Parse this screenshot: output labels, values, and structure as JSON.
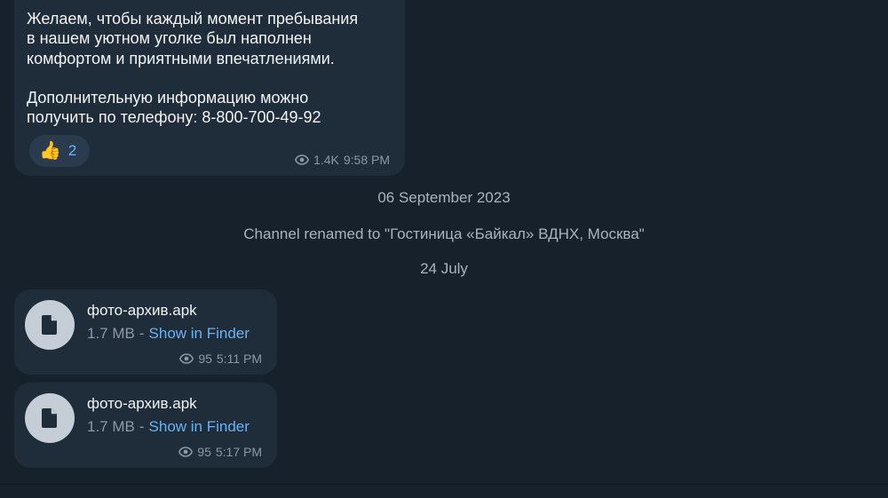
{
  "text_message": {
    "lines_1": [
      "Желаем, чтобы каждый момент пребывания",
      "в нашем уютном уголке был наполнен",
      "комфортом и приятными впечатлениями."
    ],
    "lines_2": [
      "Дополнительную информацию можно",
      "получить по телефону: 8-800-700-49-92"
    ],
    "reaction": {
      "emoji": "👍",
      "count": "2"
    },
    "views": "1.4K",
    "time": "9:58 PM"
  },
  "service": {
    "date_1": "06 September 2023",
    "rename": "Channel renamed to \"Гостиница «Байкал» ВДНХ, Москва\"",
    "date_2": "24 July"
  },
  "files": [
    {
      "name": "фото-архив.apk",
      "size": "1.7 MB",
      "separator": "-",
      "action": "Show in Finder",
      "views": "95",
      "time": "5:11 PM",
      "icon": "document-icon"
    },
    {
      "name": "фото-архив.apk",
      "size": "1.7 MB",
      "separator": "-",
      "action": "Show in Finder",
      "views": "95",
      "time": "5:17 PM",
      "icon": "document-icon"
    }
  ],
  "colors": {
    "background": "#17212b",
    "bubble": "#1f2c3a",
    "accent": "#6ab3f3",
    "meta": "#8c98a5"
  }
}
